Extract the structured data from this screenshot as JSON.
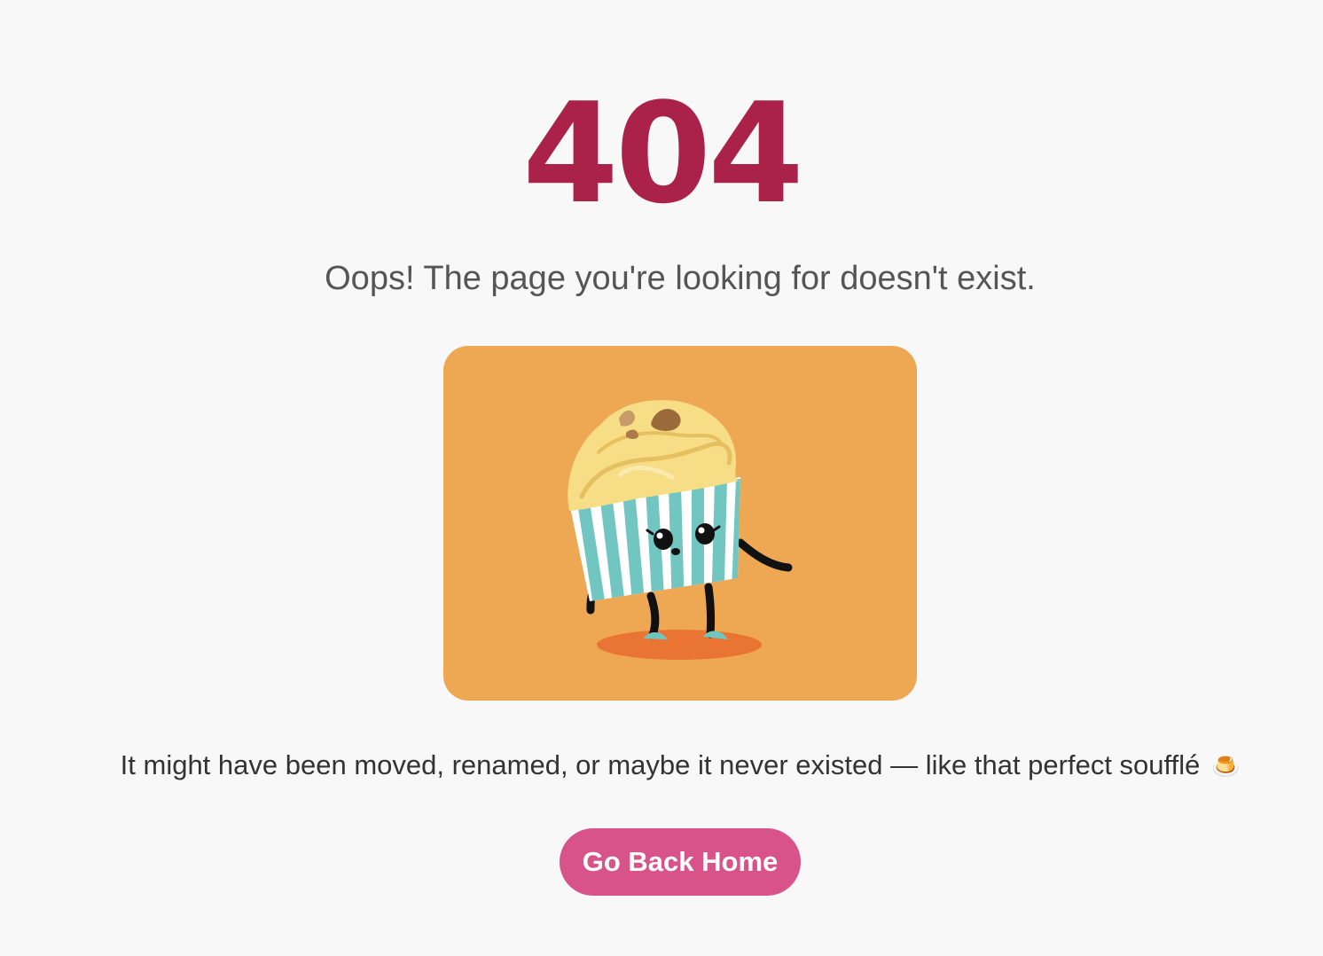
{
  "error": {
    "code": "404",
    "subtitle": "Oops! The page you're looking for doesn't exist.",
    "message": "It might have been moved, renamed, or maybe it never existed — like that perfect soufflé",
    "message_icon": "🍮"
  },
  "illustration": {
    "icon": "dancing-cupcake-illustration",
    "background_color": "#eea753"
  },
  "actions": {
    "home_button_label": "Go Back Home"
  },
  "colors": {
    "page_background": "#f8f8f8",
    "error_code": "#aa214a",
    "button": "#d8538a",
    "button_text": "#ffffff"
  }
}
